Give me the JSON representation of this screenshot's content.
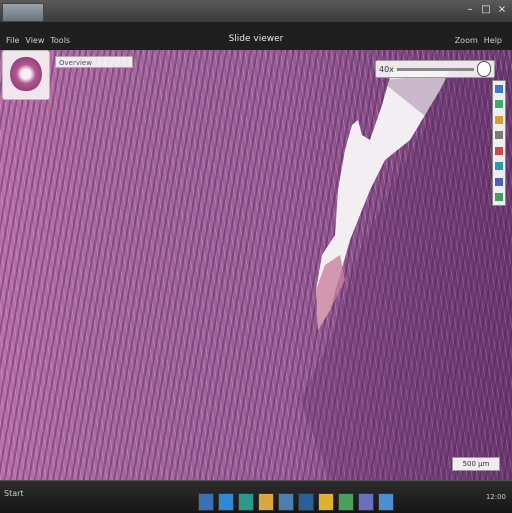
{
  "window": {
    "title": "",
    "doc_title": "Slide viewer",
    "controls": [
      "minimize",
      "maximize",
      "close"
    ]
  },
  "menubar": {
    "left_items": [
      "File",
      "View",
      "Tools"
    ],
    "right_items": [
      "Zoom",
      "Help"
    ]
  },
  "overview": {
    "info_label": "Overview",
    "zoom_label": "40x"
  },
  "scale_bar": {
    "label": "500 µm"
  },
  "taskbar": {
    "start_label": "Start",
    "tray_text": "12:00"
  },
  "colors": {
    "tissue_primary": "#9a5e96",
    "tissue_dark": "#6d3c72",
    "tissue_light": "#b76fa6",
    "lumen": "#f3eef2",
    "taskbar": "#1a1a1a"
  },
  "icons": {
    "task_icons": [
      "explorer-icon",
      "browser-icon",
      "viewer-icon",
      "folder-icon",
      "settings-icon",
      "terminal-icon",
      "mail-icon",
      "media-icon",
      "chat-icon",
      "chart-icon"
    ],
    "side_tools": [
      "pan-icon",
      "zoom-in-icon",
      "zoom-out-icon",
      "ruler-icon",
      "annotate-icon",
      "color-icon",
      "rotate-icon",
      "fit-icon"
    ]
  }
}
